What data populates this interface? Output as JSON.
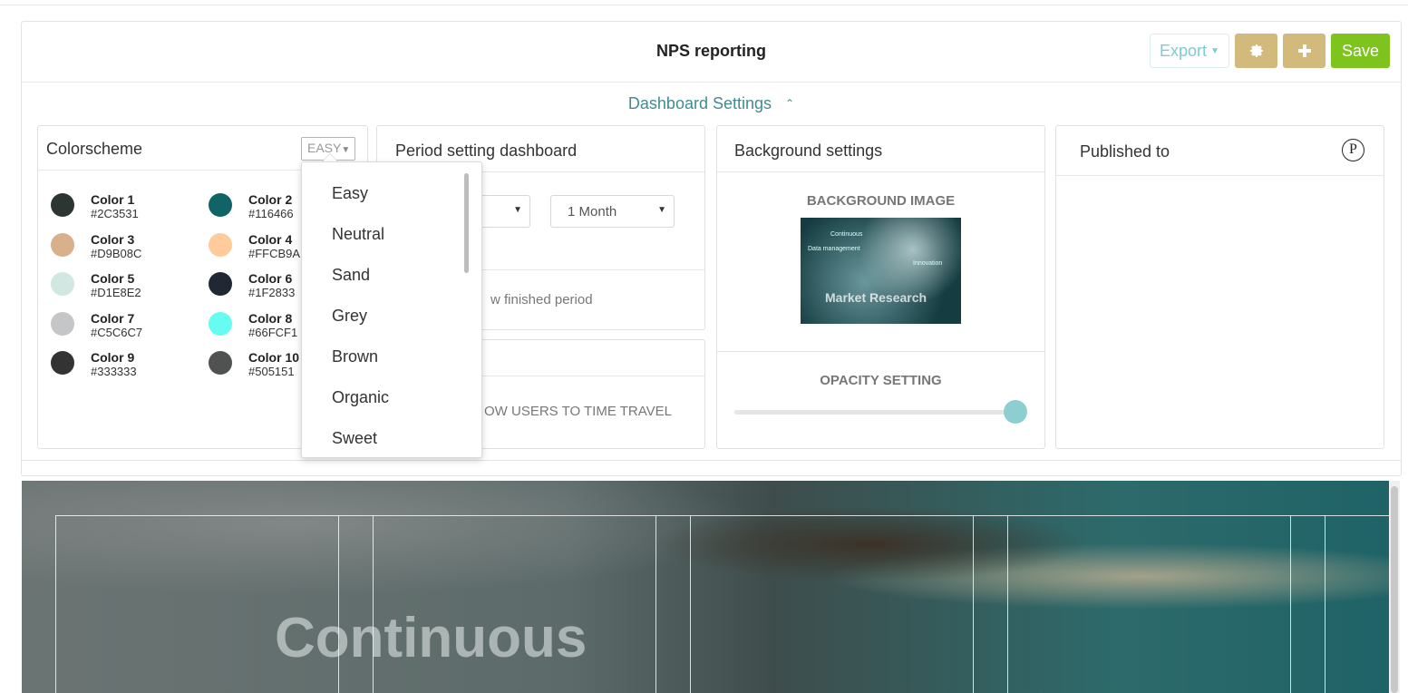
{
  "header": {
    "title": "NPS reporting",
    "export_label": "Export",
    "save_label": "Save"
  },
  "dashboard_settings": {
    "label": "Dashboard Settings"
  },
  "colorscheme": {
    "title": "Colorscheme",
    "selected": "EASY",
    "colors": [
      {
        "name": "Color 1",
        "hex": "#2C3531"
      },
      {
        "name": "Color 2",
        "hex": "#116466"
      },
      {
        "name": "Color 3",
        "hex": "#D9B08C"
      },
      {
        "name": "Color 4",
        "hex": "#FFCB9A"
      },
      {
        "name": "Color 5",
        "hex": "#D1E8E2"
      },
      {
        "name": "Color 6",
        "hex": "#1F2833"
      },
      {
        "name": "Color 7",
        "hex": "#C5C6C7"
      },
      {
        "name": "Color 8",
        "hex": "#66FCF1"
      },
      {
        "name": "Color 9",
        "hex": "#333333"
      },
      {
        "name": "Color 10",
        "hex": "#505151"
      }
    ],
    "options": [
      "Easy",
      "Neutral",
      "Sand",
      "Grey",
      "Brown",
      "Organic",
      "Sweet"
    ]
  },
  "period": {
    "title": "Period setting dashboard",
    "select_value": "1 Month",
    "finished_text": "w finished period",
    "time_travel_text": "OW USERS TO TIME TRAVEL"
  },
  "background": {
    "title": "Background settings",
    "image_label": "BACKGROUND IMAGE",
    "opacity_label": "OPACITY SETTING",
    "opacity_value": 1.0,
    "thumb_texts": [
      "Continuous",
      "Data management",
      "Innovation",
      "Market Research"
    ]
  },
  "published": {
    "title": "Published to",
    "icon_letter": "P"
  },
  "hero": {
    "text": "Continuous"
  }
}
